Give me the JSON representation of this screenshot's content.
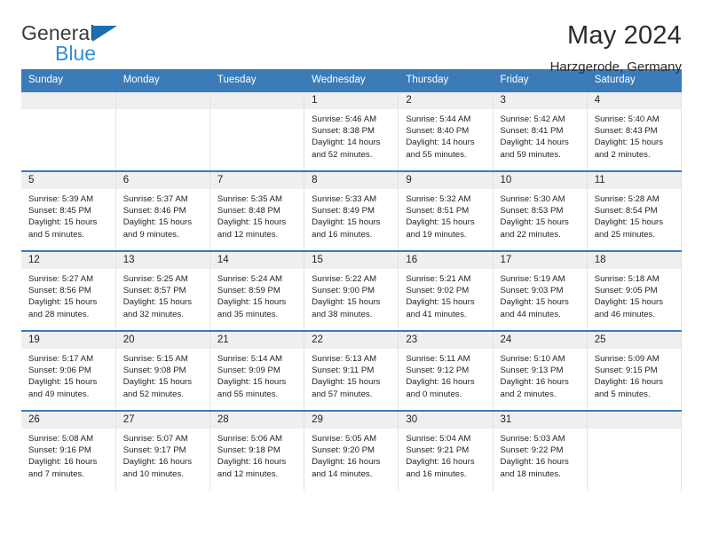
{
  "brand": {
    "name_part1": "General",
    "name_part2": "Blue",
    "triangle_color": "#1a6fb4",
    "blue_color": "#2e8fd4"
  },
  "header": {
    "title": "May 2024",
    "location": "Harzgerode, Germany"
  },
  "theme": {
    "header_bg": "#3b7cb8",
    "daynum_bg": "#efefef",
    "text": "#231f20"
  },
  "calendar": {
    "weekday_headers": [
      "Sunday",
      "Monday",
      "Tuesday",
      "Wednesday",
      "Thursday",
      "Friday",
      "Saturday"
    ],
    "leading_blanks": 3,
    "days": [
      {
        "n": "1",
        "sunrise": "Sunrise: 5:46 AM",
        "sunset": "Sunset: 8:38 PM",
        "daylight1": "Daylight: 14 hours",
        "daylight2": "and 52 minutes."
      },
      {
        "n": "2",
        "sunrise": "Sunrise: 5:44 AM",
        "sunset": "Sunset: 8:40 PM",
        "daylight1": "Daylight: 14 hours",
        "daylight2": "and 55 minutes."
      },
      {
        "n": "3",
        "sunrise": "Sunrise: 5:42 AM",
        "sunset": "Sunset: 8:41 PM",
        "daylight1": "Daylight: 14 hours",
        "daylight2": "and 59 minutes."
      },
      {
        "n": "4",
        "sunrise": "Sunrise: 5:40 AM",
        "sunset": "Sunset: 8:43 PM",
        "daylight1": "Daylight: 15 hours",
        "daylight2": "and 2 minutes."
      },
      {
        "n": "5",
        "sunrise": "Sunrise: 5:39 AM",
        "sunset": "Sunset: 8:45 PM",
        "daylight1": "Daylight: 15 hours",
        "daylight2": "and 5 minutes."
      },
      {
        "n": "6",
        "sunrise": "Sunrise: 5:37 AM",
        "sunset": "Sunset: 8:46 PM",
        "daylight1": "Daylight: 15 hours",
        "daylight2": "and 9 minutes."
      },
      {
        "n": "7",
        "sunrise": "Sunrise: 5:35 AM",
        "sunset": "Sunset: 8:48 PM",
        "daylight1": "Daylight: 15 hours",
        "daylight2": "and 12 minutes."
      },
      {
        "n": "8",
        "sunrise": "Sunrise: 5:33 AM",
        "sunset": "Sunset: 8:49 PM",
        "daylight1": "Daylight: 15 hours",
        "daylight2": "and 16 minutes."
      },
      {
        "n": "9",
        "sunrise": "Sunrise: 5:32 AM",
        "sunset": "Sunset: 8:51 PM",
        "daylight1": "Daylight: 15 hours",
        "daylight2": "and 19 minutes."
      },
      {
        "n": "10",
        "sunrise": "Sunrise: 5:30 AM",
        "sunset": "Sunset: 8:53 PM",
        "daylight1": "Daylight: 15 hours",
        "daylight2": "and 22 minutes."
      },
      {
        "n": "11",
        "sunrise": "Sunrise: 5:28 AM",
        "sunset": "Sunset: 8:54 PM",
        "daylight1": "Daylight: 15 hours",
        "daylight2": "and 25 minutes."
      },
      {
        "n": "12",
        "sunrise": "Sunrise: 5:27 AM",
        "sunset": "Sunset: 8:56 PM",
        "daylight1": "Daylight: 15 hours",
        "daylight2": "and 28 minutes."
      },
      {
        "n": "13",
        "sunrise": "Sunrise: 5:25 AM",
        "sunset": "Sunset: 8:57 PM",
        "daylight1": "Daylight: 15 hours",
        "daylight2": "and 32 minutes."
      },
      {
        "n": "14",
        "sunrise": "Sunrise: 5:24 AM",
        "sunset": "Sunset: 8:59 PM",
        "daylight1": "Daylight: 15 hours",
        "daylight2": "and 35 minutes."
      },
      {
        "n": "15",
        "sunrise": "Sunrise: 5:22 AM",
        "sunset": "Sunset: 9:00 PM",
        "daylight1": "Daylight: 15 hours",
        "daylight2": "and 38 minutes."
      },
      {
        "n": "16",
        "sunrise": "Sunrise: 5:21 AM",
        "sunset": "Sunset: 9:02 PM",
        "daylight1": "Daylight: 15 hours",
        "daylight2": "and 41 minutes."
      },
      {
        "n": "17",
        "sunrise": "Sunrise: 5:19 AM",
        "sunset": "Sunset: 9:03 PM",
        "daylight1": "Daylight: 15 hours",
        "daylight2": "and 44 minutes."
      },
      {
        "n": "18",
        "sunrise": "Sunrise: 5:18 AM",
        "sunset": "Sunset: 9:05 PM",
        "daylight1": "Daylight: 15 hours",
        "daylight2": "and 46 minutes."
      },
      {
        "n": "19",
        "sunrise": "Sunrise: 5:17 AM",
        "sunset": "Sunset: 9:06 PM",
        "daylight1": "Daylight: 15 hours",
        "daylight2": "and 49 minutes."
      },
      {
        "n": "20",
        "sunrise": "Sunrise: 5:15 AM",
        "sunset": "Sunset: 9:08 PM",
        "daylight1": "Daylight: 15 hours",
        "daylight2": "and 52 minutes."
      },
      {
        "n": "21",
        "sunrise": "Sunrise: 5:14 AM",
        "sunset": "Sunset: 9:09 PM",
        "daylight1": "Daylight: 15 hours",
        "daylight2": "and 55 minutes."
      },
      {
        "n": "22",
        "sunrise": "Sunrise: 5:13 AM",
        "sunset": "Sunset: 9:11 PM",
        "daylight1": "Daylight: 15 hours",
        "daylight2": "and 57 minutes."
      },
      {
        "n": "23",
        "sunrise": "Sunrise: 5:11 AM",
        "sunset": "Sunset: 9:12 PM",
        "daylight1": "Daylight: 16 hours",
        "daylight2": "and 0 minutes."
      },
      {
        "n": "24",
        "sunrise": "Sunrise: 5:10 AM",
        "sunset": "Sunset: 9:13 PM",
        "daylight1": "Daylight: 16 hours",
        "daylight2": "and 2 minutes."
      },
      {
        "n": "25",
        "sunrise": "Sunrise: 5:09 AM",
        "sunset": "Sunset: 9:15 PM",
        "daylight1": "Daylight: 16 hours",
        "daylight2": "and 5 minutes."
      },
      {
        "n": "26",
        "sunrise": "Sunrise: 5:08 AM",
        "sunset": "Sunset: 9:16 PM",
        "daylight1": "Daylight: 16 hours",
        "daylight2": "and 7 minutes."
      },
      {
        "n": "27",
        "sunrise": "Sunrise: 5:07 AM",
        "sunset": "Sunset: 9:17 PM",
        "daylight1": "Daylight: 16 hours",
        "daylight2": "and 10 minutes."
      },
      {
        "n": "28",
        "sunrise": "Sunrise: 5:06 AM",
        "sunset": "Sunset: 9:18 PM",
        "daylight1": "Daylight: 16 hours",
        "daylight2": "and 12 minutes."
      },
      {
        "n": "29",
        "sunrise": "Sunrise: 5:05 AM",
        "sunset": "Sunset: 9:20 PM",
        "daylight1": "Daylight: 16 hours",
        "daylight2": "and 14 minutes."
      },
      {
        "n": "30",
        "sunrise": "Sunrise: 5:04 AM",
        "sunset": "Sunset: 9:21 PM",
        "daylight1": "Daylight: 16 hours",
        "daylight2": "and 16 minutes."
      },
      {
        "n": "31",
        "sunrise": "Sunrise: 5:03 AM",
        "sunset": "Sunset: 9:22 PM",
        "daylight1": "Daylight: 16 hours",
        "daylight2": "and 18 minutes."
      }
    ]
  }
}
